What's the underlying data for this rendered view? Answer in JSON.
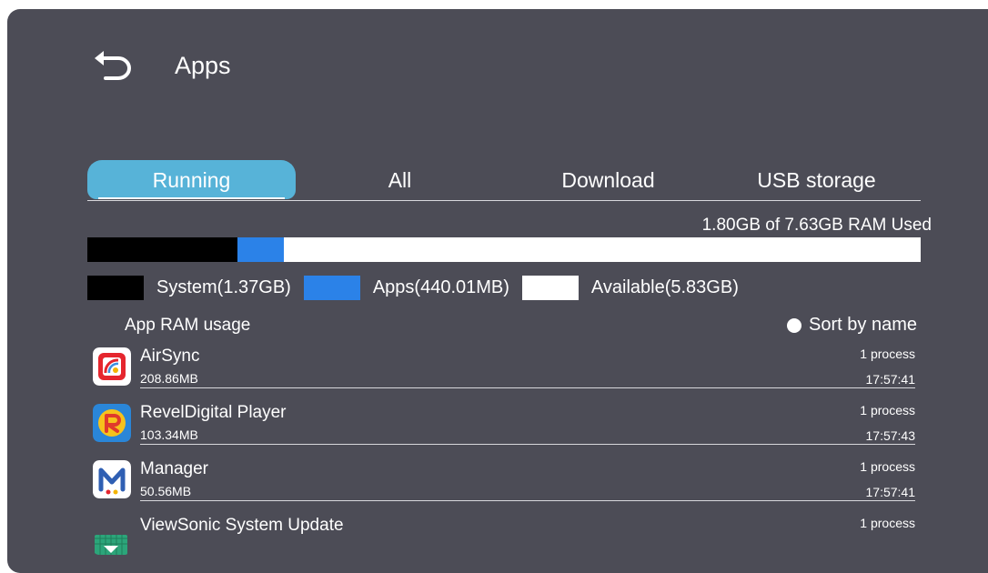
{
  "header": {
    "back_icon": "back-arrow-icon",
    "title": "Apps"
  },
  "tabs": [
    {
      "label": "Running",
      "active": true
    },
    {
      "label": "All",
      "active": false
    },
    {
      "label": "Download",
      "active": false
    },
    {
      "label": "USB storage",
      "active": false
    }
  ],
  "ram": {
    "used_text": "1.80GB of 7.63GB RAM Used",
    "system_fraction": 0.1796,
    "apps_fraction": 0.0563,
    "legend": {
      "system": "System(1.37GB)",
      "apps": "Apps(440.01MB)",
      "available": "Available(5.83GB)"
    },
    "colors": {
      "system": "#000000",
      "apps": "#2b82e8",
      "available": "#ffffff"
    }
  },
  "section": {
    "title": "App RAM usage",
    "sort_label": "Sort by name"
  },
  "apps": [
    {
      "name": "AirSync",
      "size": "208.86MB",
      "process": "1 process",
      "time": "17:57:41",
      "icon": "airsync-icon"
    },
    {
      "name": "RevelDigital Player",
      "size": "103.34MB",
      "process": "1 process",
      "time": "17:57:43",
      "icon": "reveldigital-icon"
    },
    {
      "name": "Manager",
      "size": "50.56MB",
      "process": "1 process",
      "time": "17:57:41",
      "icon": "manager-icon"
    },
    {
      "name": "ViewSonic System Update",
      "size": "",
      "process": "1 process",
      "time": "",
      "icon": "system-update-icon"
    }
  ],
  "colors": {
    "panel_bg": "#4c4c56",
    "accent": "#57b3d8"
  }
}
